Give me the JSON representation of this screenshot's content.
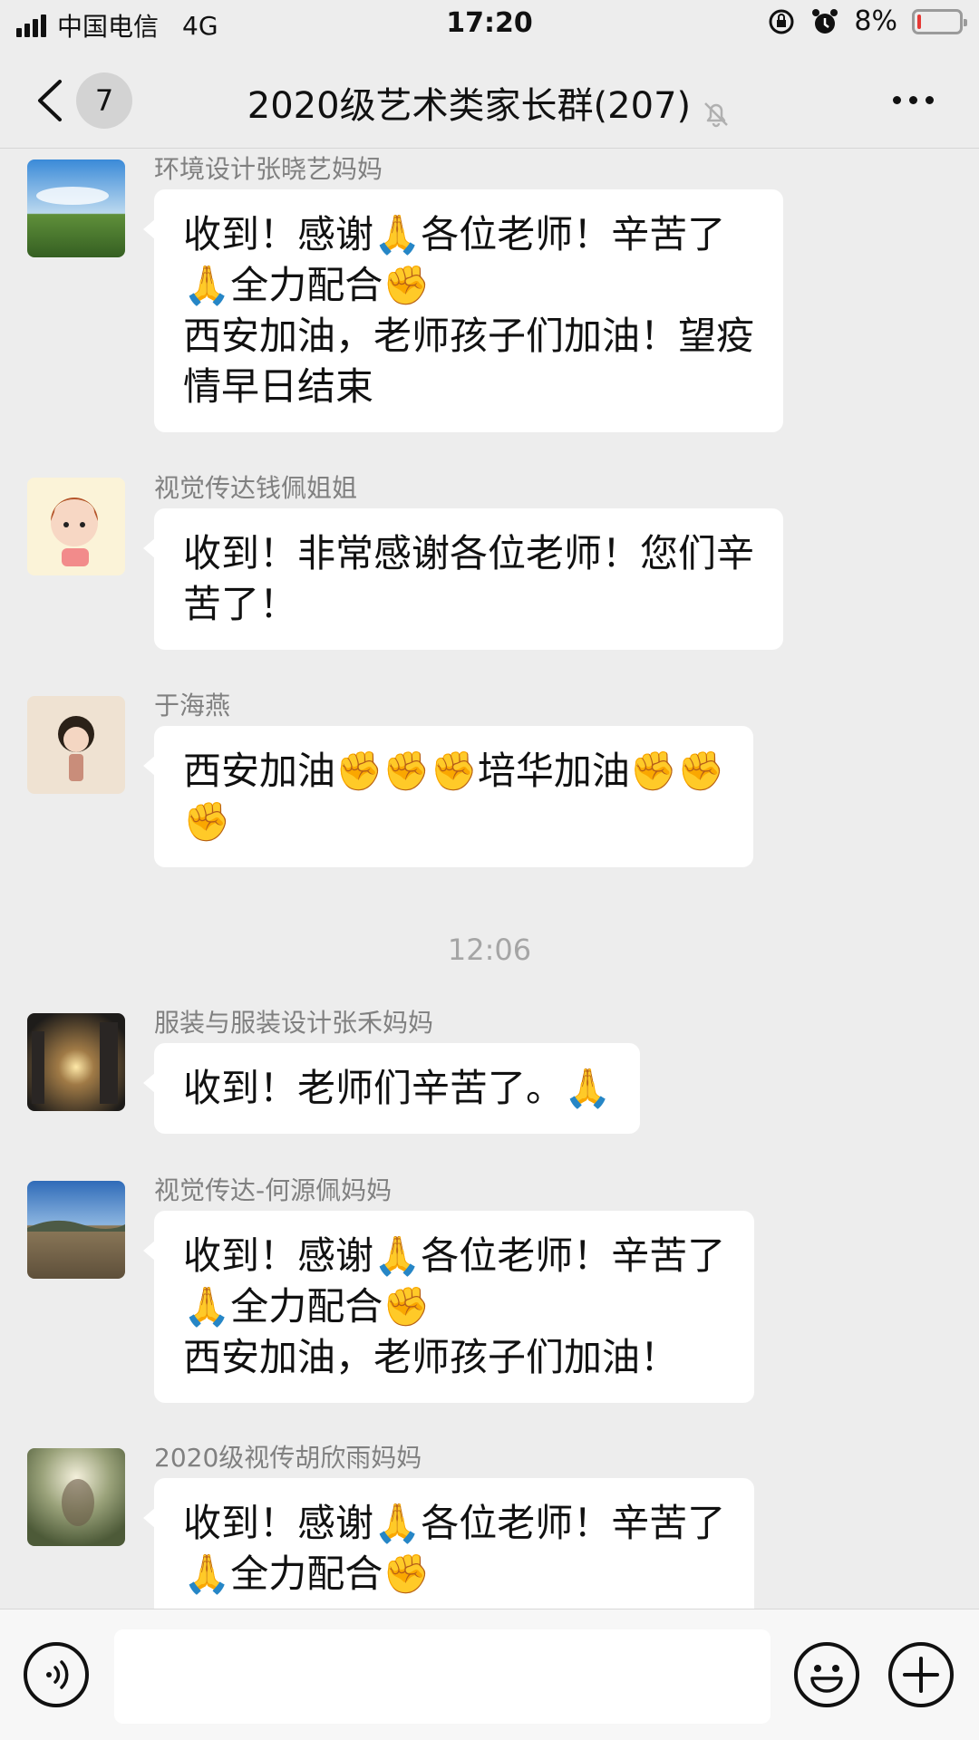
{
  "status_bar": {
    "carrier": "中国电信",
    "network": "4G",
    "time": "17:20",
    "battery": "8%",
    "battery_level": 0.08,
    "icons": [
      "signal-icon",
      "rotation-lock-icon",
      "alarm-icon",
      "battery-icon"
    ]
  },
  "nav": {
    "unread_count": "7",
    "title": "2020级艺术类家长群(207)",
    "icons": [
      "back-chevron-icon",
      "muted-bell-icon",
      "more-icon"
    ]
  },
  "messages": [
    {
      "sender": "环境设计张晓艺妈妈",
      "lines": [
        "收到！感谢🙏各位老师！辛苦了",
        "🙏全力配合✊",
        "西安加油，老师孩子们加油！望疫",
        "情早日结束"
      ],
      "avatar": "grassland-photo"
    },
    {
      "sender": "视觉传达钱佩姐姐",
      "lines": [
        "收到！非常感谢各位老师！您们辛",
        "苦了！"
      ],
      "avatar": "cartoon-girl"
    },
    {
      "sender": "于海燕",
      "lines": [
        "西安加油✊✊✊培华加油✊✊",
        "✊"
      ],
      "avatar": "cartoon-girl-2"
    },
    {
      "sender": "服装与服装设计张禾妈妈",
      "lines": [
        "收到！老师们辛苦了。🙏"
      ],
      "avatar": "sunset-photo"
    },
    {
      "sender": "视觉传达-何源佩妈妈",
      "lines": [
        "收到！感谢🙏各位老师！辛苦了",
        "🙏全力配合✊",
        "西安加油，老师孩子们加油！"
      ],
      "avatar": "landscape-photo"
    },
    {
      "sender": "2020级视传胡欣雨妈妈",
      "lines": [
        "收到！感谢🙏各位老师！辛苦了",
        "🙏全力配合✊"
      ],
      "avatar": "forest-photo"
    }
  ],
  "timestamp": "12:06",
  "input_bar": {
    "icons": [
      "voice-icon",
      "emoji-icon",
      "plus-icon"
    ],
    "value": ""
  }
}
